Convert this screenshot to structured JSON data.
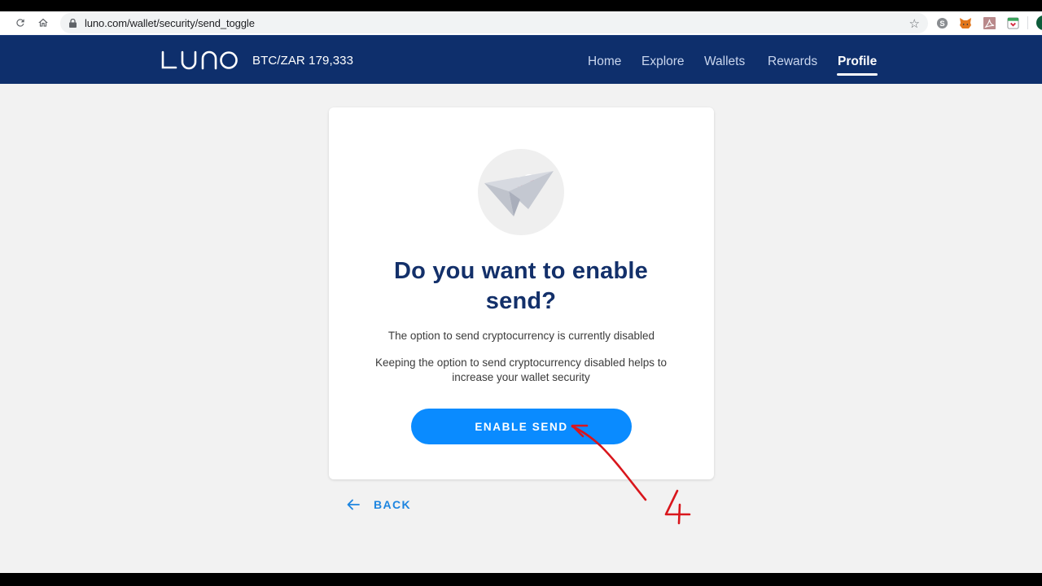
{
  "browser": {
    "url": "luno.com/wallet/security/send_toggle",
    "icons": [
      "reload-icon",
      "home-icon",
      "lock-icon",
      "star-icon",
      "skype-icon",
      "metamask-icon",
      "pdf-icon",
      "pocket-icon",
      "profile-avatar"
    ]
  },
  "header": {
    "logo": "LUNO",
    "ticker": "BTC/ZAR 179,333",
    "nav": [
      {
        "label": "Home",
        "active": false
      },
      {
        "label": "Explore",
        "active": false
      },
      {
        "label": "Wallets",
        "active": false
      },
      {
        "label": "Rewards",
        "active": false
      },
      {
        "label": "Profile",
        "active": true
      }
    ]
  },
  "card": {
    "illustration": "paper-plane-with-crypto-coins",
    "title": "Do you want to enable send?",
    "description_1": "The option to send cryptocurrency is currently disabled",
    "description_2": "Keeping the option to send cryptocurrency disabled helps to increase your wallet security",
    "enable_button": "ENABLE SEND"
  },
  "back": {
    "label": "BACK"
  },
  "annotation": {
    "step_number": "4",
    "color": "#d9161c"
  },
  "colors": {
    "header_bg": "#0e2f6c",
    "primary_button": "#0a8bff",
    "title": "#13306a",
    "link": "#1d85e0",
    "page_bg": "#f2f2f2"
  }
}
